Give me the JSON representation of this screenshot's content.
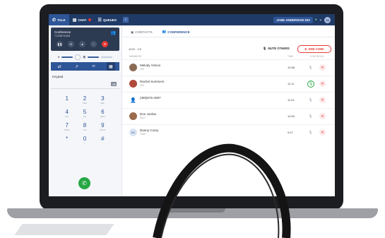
{
  "topbar": {
    "tabs": [
      {
        "icon": "phone-icon",
        "label": "TALK"
      },
      {
        "icon": "chat-icon",
        "label": "CHAT"
      },
      {
        "icon": "queues-icon",
        "label": "QUEUES"
      }
    ],
    "user_label": "JANE ANDERSON 203",
    "avatar_initials": "JA"
  },
  "call_card": {
    "title": "Conference",
    "number": "7125874005",
    "buttons": [
      "pause-icon",
      "mute-icon",
      "record-icon",
      "more-icon",
      "hangup-icon"
    ]
  },
  "toolbar_icons": [
    "transfer-icon",
    "call-forward-icon",
    "link-icon",
    "keypad-icon"
  ],
  "keypad": {
    "label": "Keypad",
    "keys": [
      {
        "digit": "1",
        "letters": ""
      },
      {
        "digit": "2",
        "letters": "ABC"
      },
      {
        "digit": "3",
        "letters": "DEF"
      },
      {
        "digit": "4",
        "letters": "GHI"
      },
      {
        "digit": "5",
        "letters": "JKL"
      },
      {
        "digit": "6",
        "letters": "MNO"
      },
      {
        "digit": "7",
        "letters": "PQRS"
      },
      {
        "digit": "8",
        "letters": "TUV"
      },
      {
        "digit": "9",
        "letters": "WXYZ"
      },
      {
        "digit": "*",
        "letters": ""
      },
      {
        "digit": "0",
        "letters": "+"
      },
      {
        "digit": "#",
        "letters": ""
      }
    ]
  },
  "main": {
    "tabs": [
      {
        "icon": "contacts-icon",
        "label": "CONTACTS"
      },
      {
        "icon": "conference-icon",
        "label": "CONFERENCE"
      }
    ],
    "meta": "4020 · 1/9",
    "mute_others_label": "MUTE OTHERS",
    "end_conf_label": "END CONF",
    "columns": {
      "members": "MEMBERS",
      "time": "TIME",
      "controls": "CONTROLS"
    },
    "participants": [
      {
        "name": "Melody Vinson",
        "ext": "203",
        "time": "10:58",
        "mic": "muted",
        "avatar": "#8b6a55"
      },
      {
        "name": "Rachel Summers",
        "ext": "202",
        "time": "11:11",
        "mic": "active",
        "avatar": "#b04a3a"
      },
      {
        "name": "(385)575-4087",
        "ext": "",
        "time": "11:01",
        "mic": "muted",
        "avatar": "person-icon"
      },
      {
        "name": "Don Jordan",
        "ext": "3017",
        "time": "10:50",
        "mic": "muted",
        "avatar": "#9a6b4c"
      },
      {
        "name": "Danny Corey",
        "ext": "7053",
        "time": "9:47",
        "mic": "muted",
        "avatar": "initials"
      }
    ]
  }
}
